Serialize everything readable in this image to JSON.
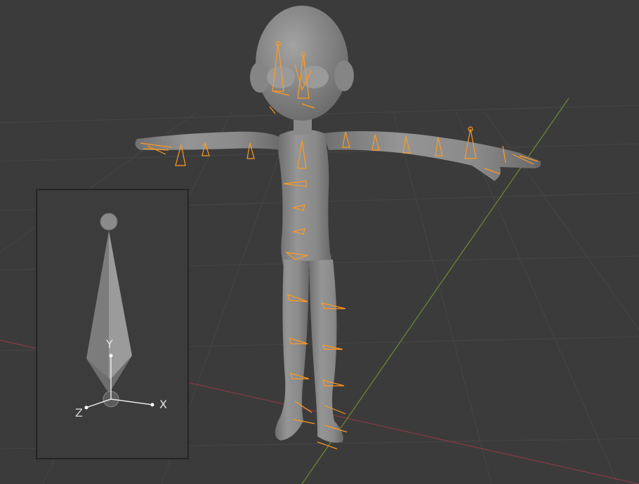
{
  "app": "3D viewport",
  "inset": {
    "axes": {
      "x": "X",
      "y": "Y",
      "z": "Z"
    }
  },
  "colors": {
    "background": "#3b3b3b",
    "grid": "#474747",
    "axis_x": "#8a3a44",
    "axis_y": "#6c8a2e",
    "bone_outline": "#ff9a1f",
    "mesh": "#8c8c8c",
    "bone_shaded": "#7a7a7a"
  }
}
